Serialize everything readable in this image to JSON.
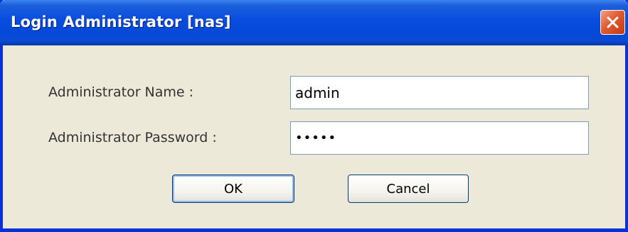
{
  "window": {
    "title": "Login Administrator [nas]"
  },
  "title_bar": {
    "close_icon": "close-icon"
  },
  "form": {
    "name_label": "Administrator Name :",
    "name_value": "admin",
    "password_label": "Administrator Password :",
    "password_value": "admin"
  },
  "buttons": {
    "ok_label": "OK",
    "cancel_label": "Cancel"
  },
  "colors": {
    "title_bar": "#0549d9",
    "window_frame": "#0831d9",
    "dialog_background": "#ece9d8",
    "close_button": "#e25a30",
    "input_border": "#7f9db9"
  }
}
